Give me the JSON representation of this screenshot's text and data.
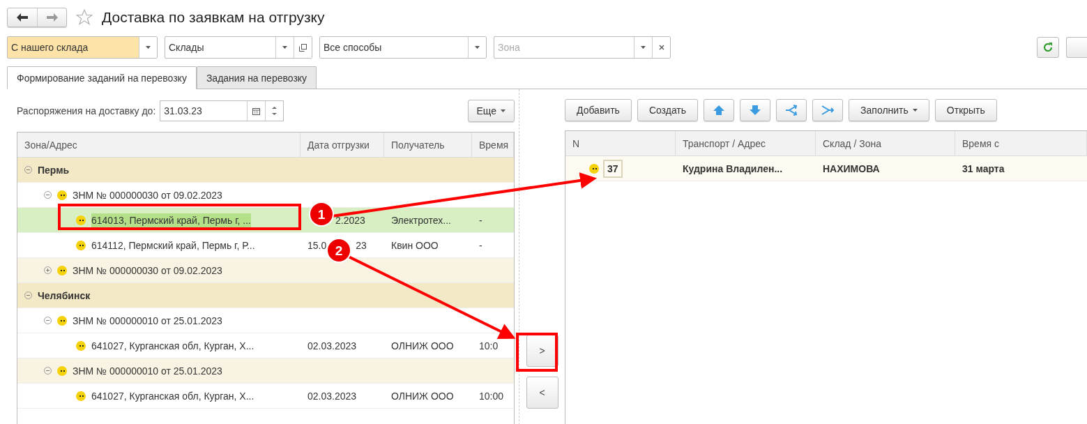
{
  "window": {
    "title": "Доставка по заявкам на отгрузку",
    "favorite": false
  },
  "filters": [
    {
      "kind": "select",
      "value": "С нашего склада",
      "highlighted": true
    },
    {
      "kind": "select-open",
      "value": "Склады",
      "highlighted": false
    },
    {
      "kind": "select",
      "value": "Все способы",
      "highlighted": false
    },
    {
      "kind": "select-clear",
      "placeholder": "Зона",
      "highlighted": false
    }
  ],
  "tabs": [
    {
      "label": "Формирование заданий на перевозку",
      "selected": true
    },
    {
      "label": "Задания на перевозку",
      "selected": false
    }
  ],
  "left": {
    "date_label": "Распоряжения на доставку до:",
    "date_value": "31.03.23",
    "more_button": "Еще",
    "columns": [
      "Зона/Адрес",
      "Дата отгрузки",
      "Получатель",
      "Время"
    ],
    "rows": [
      {
        "kind": "group",
        "label": "Пермь",
        "expanded": true,
        "children": [
          {
            "kind": "order",
            "label": "ЗНМ № 000000030 от 09.02.2023",
            "expanded": true,
            "children": [
              {
                "kind": "address",
                "label": "614013, Пермский край, Пермь г, ...",
                "date_parts": [
                  "2.2023"
                ],
                "recipient": "Электротех...",
                "time": "-",
                "selected": true
              },
              {
                "kind": "address",
                "label": "614112, Пермский край, Пермь г, Р...",
                "date_parts": [
                  "15.0",
                  "23"
                ],
                "recipient": "Квин ООО",
                "time": "-",
                "selected": false
              }
            ]
          },
          {
            "kind": "order",
            "label": "ЗНМ № 000000030 от 09.02.2023",
            "expanded": false
          }
        ]
      },
      {
        "kind": "group",
        "label": "Челябинск",
        "expanded": true,
        "children": [
          {
            "kind": "order",
            "label": "ЗНМ № 000000010 от 25.01.2023",
            "expanded": true,
            "children": [
              {
                "kind": "address",
                "label": "641027, Курганская обл, Курган, Х...",
                "date_parts": [
                  "02.03.2023"
                ],
                "recipient": "ОЛНИЖ ООО",
                "time": "10:0",
                "selected": false
              }
            ]
          },
          {
            "kind": "order",
            "label": "ЗНМ № 000000010 от 25.01.2023",
            "expanded": true,
            "children": [
              {
                "kind": "address",
                "label": "641027, Курганская обл, Курган, Х...",
                "date_parts": [
                  "02.03.2023"
                ],
                "recipient": "ОЛНИЖ ООО",
                "time": "10:00",
                "selected": false
              }
            ]
          }
        ]
      }
    ]
  },
  "move_buttons": [
    ">",
    "<"
  ],
  "right": {
    "toolbar": [
      {
        "kind": "text",
        "label": "Добавить"
      },
      {
        "kind": "text",
        "label": "Создать"
      },
      {
        "kind": "up"
      },
      {
        "kind": "down"
      },
      {
        "kind": "split"
      },
      {
        "kind": "merge"
      },
      {
        "kind": "menu",
        "label": "Заполнить"
      },
      {
        "kind": "text",
        "label": "Открыть"
      }
    ],
    "columns": [
      "N",
      "Транспорт / Адрес",
      "Склад / Зона",
      "Время с"
    ],
    "rows": [
      {
        "number": "37",
        "transport": "Кудрина Владилен...",
        "zone": "НАХИМОВА",
        "time": "31 марта"
      }
    ]
  },
  "callouts": [
    {
      "number": "1"
    },
    {
      "number": "2"
    }
  ]
}
